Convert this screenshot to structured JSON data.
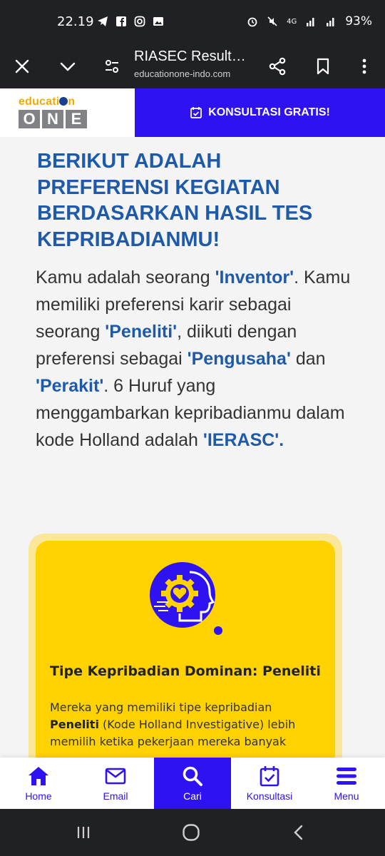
{
  "status_bar": {
    "time": "22.19",
    "network": "4G",
    "battery": "93%",
    "icons": [
      "telegram-icon",
      "facebook-icon",
      "instagram-icon",
      "gallery-icon",
      "alarm-icon",
      "mute-icon",
      "signal-icon",
      "battery-icon"
    ]
  },
  "browser": {
    "title": "RIASEC Result…",
    "url": "educationone-indo.com"
  },
  "site_header": {
    "logo_top": "educati",
    "logo_top_end": "n",
    "logo_letters": [
      "O",
      "N",
      "E"
    ],
    "cta_label": "KONSULTASI GRATIS!"
  },
  "content": {
    "headline": "BERIKUT ADALAH PREFERENSI KEGIATAN BERDASARKAN HASIL TES KEPRIBADIANMU!",
    "intro": {
      "p1": "Kamu adalah seorang ",
      "type": "'Inventor'",
      "p2": ". Kamu memiliki preferensi karir sebagai seorang ",
      "career1": "'Peneliti'",
      "p3": ", diikuti dengan preferensi sebagai ",
      "career2": "'Pengusaha'",
      "p4": " dan ",
      "career3": "'Perakit'",
      "p5": ". 6 Huruf yang menggambarkan kepribadianmu dalam kode Holland adalah ",
      "code": "'IERASC'",
      "p6": "."
    },
    "card": {
      "title": "Tipe Kepribadian Dominan: Peneliti",
      "text_1": "Mereka yang memiliki tipe kepribadian ",
      "text_bold": "Peneliti",
      "text_2": " (Kode Holland Investigative) lebih memilih ketika pekerjaan mereka banyak"
    }
  },
  "bottom_nav": {
    "items": [
      {
        "label": "Home",
        "icon": "home-icon"
      },
      {
        "label": "Email",
        "icon": "email-icon"
      },
      {
        "label": "Cari",
        "icon": "search-icon"
      },
      {
        "label": "Konsultasi",
        "icon": "calendar-check-icon"
      },
      {
        "label": "Menu",
        "icon": "menu-icon"
      }
    ]
  },
  "colors": {
    "brand_blue": "#2f12f2",
    "headline_blue": "#1e5aa8",
    "card_yellow": "#ffd200",
    "logo_orange": "#f2a900"
  }
}
